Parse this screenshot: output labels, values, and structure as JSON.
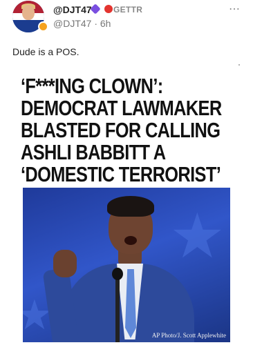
{
  "post": {
    "username": "@DJT47",
    "platform": "GETTR",
    "handle": "@DJT47 · 6h",
    "more_icon": "⋯",
    "text": "Dude is a POS."
  },
  "article": {
    "headline_lines": [
      "‘F***ING CLOWN’:",
      "DEMOCRAT LAWMAKER",
      "BLASTED FOR CALLING",
      "ASHLI BABBITT A",
      "‘DOMESTIC TERRORIST’"
    ],
    "photo_credit": "AP Photo/J. Scott Applewhite"
  },
  "colors": {
    "badge_purple": "#7a4fe0",
    "badge_red": "#e3342f",
    "badge_orange": "#f6a21e",
    "photo_blue": "#3156c9"
  },
  "icons": {
    "avatar": "avatar",
    "more": "more-options-icon",
    "verified": "verified-badge-icon"
  }
}
